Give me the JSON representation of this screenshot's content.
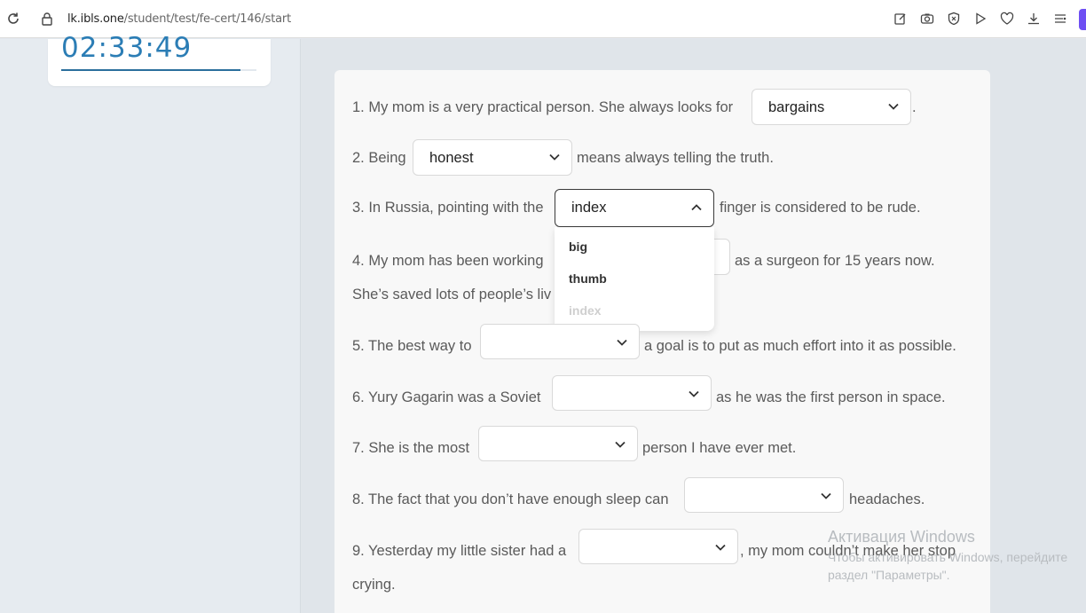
{
  "browser": {
    "url_host": "lk.ibls.one",
    "url_path": "/student/test/fe-cert/146/start",
    "toolbar_icons": [
      "edit-icon",
      "camera-icon",
      "shield-icon",
      "play-icon",
      "heart-icon",
      "download-icon",
      "menu-icon"
    ]
  },
  "timer": {
    "value": "02:33:49",
    "progress": 0.92
  },
  "questions": [
    {
      "n": "1",
      "before": "1. My mom is a very practical person. She always looks for",
      "selected": "bargains",
      "after": "."
    },
    {
      "n": "2",
      "before": "2. Being",
      "selected": "honest",
      "after": "means always telling the truth."
    },
    {
      "n": "3",
      "before": "3. In Russia, pointing with the",
      "selected": "index",
      "after": "finger is considered to be rude."
    },
    {
      "n": "4",
      "before": "4. My mom has been working",
      "selected": "",
      "after": "as a surgeon for 15 years now.",
      "line2": "She’s saved lots of people’s liv"
    },
    {
      "n": "5",
      "before": "5. The best way to",
      "selected": "",
      "after": "a goal is to put as much effort into it as possible."
    },
    {
      "n": "6",
      "before": "6. Yury Gagarin was a Soviet",
      "selected": "",
      "after": "as he was the first person in space."
    },
    {
      "n": "7",
      "before": "7. She is the most",
      "selected": "",
      "after": "person I have ever met."
    },
    {
      "n": "8",
      "before": "8. The fact that you don’t have enough sleep can",
      "selected": "",
      "after": "headaches."
    },
    {
      "n": "9",
      "before": "9. Yesterday my little sister had a",
      "selected": "",
      "after": ", my mom couldn’t make her stop",
      "line2": "crying."
    }
  ],
  "dropdown": {
    "options": [
      "big",
      "thumb",
      "index"
    ],
    "current": "index"
  },
  "watermark": {
    "title": "Активация Windows",
    "line1": "Чтобы активировать Windows, перейдите",
    "line2": "раздел \"Параметры\"."
  }
}
